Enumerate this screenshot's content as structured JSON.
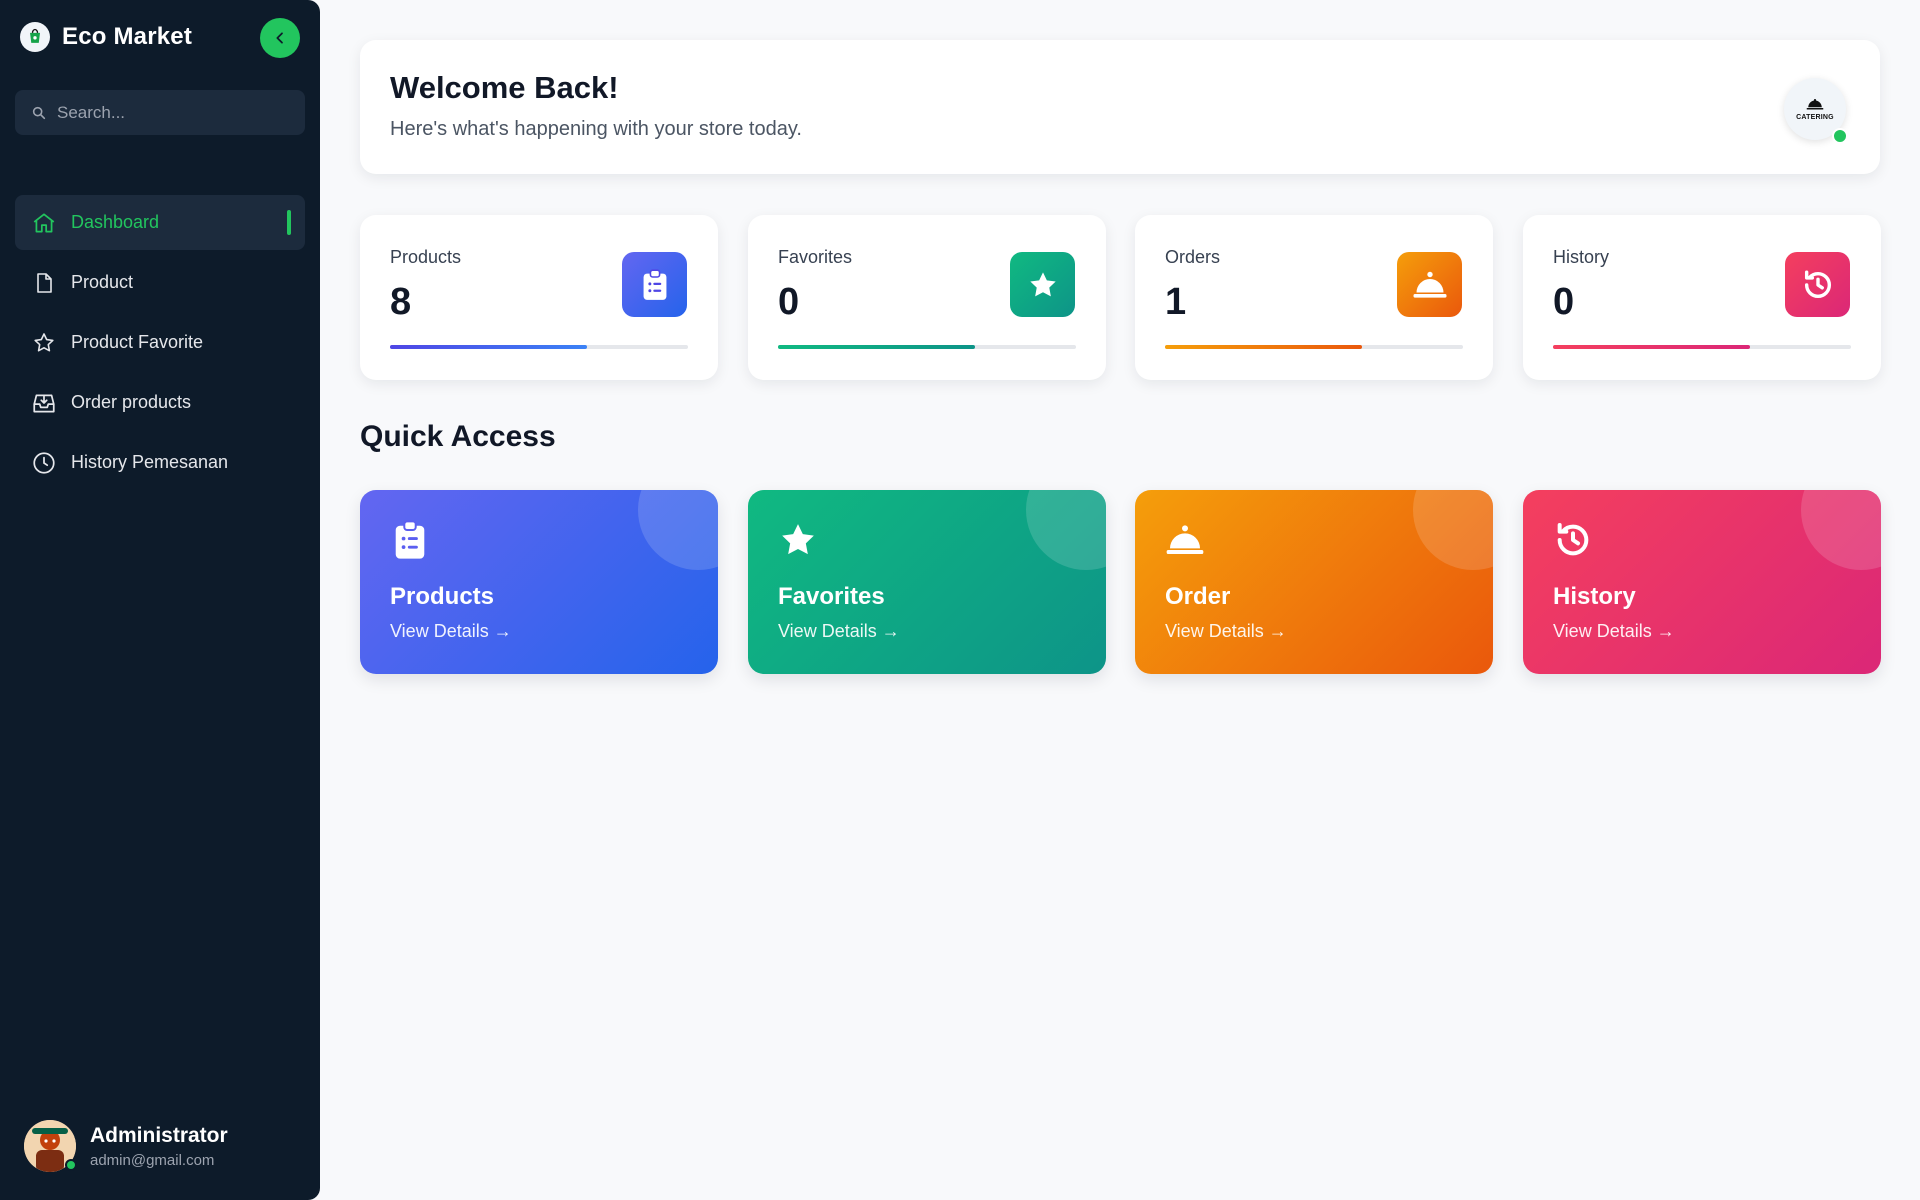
{
  "brand": {
    "name": "Eco Market"
  },
  "search": {
    "placeholder": "Search..."
  },
  "sidebar": {
    "items": [
      {
        "label": "Dashboard",
        "icon": "home-icon",
        "active": true
      },
      {
        "label": "Product",
        "icon": "file-icon"
      },
      {
        "label": "Product Favorite",
        "icon": "star-outline-icon"
      },
      {
        "label": "Order products",
        "icon": "inbox-download-icon"
      },
      {
        "label": "History Pemesanan",
        "icon": "clock-icon"
      }
    ]
  },
  "profile": {
    "name": "Administrator",
    "email": "admin@gmail.com"
  },
  "welcome": {
    "title": "Welcome Back!",
    "subtitle": "Here's what's happening with your store today.",
    "store_logo_text": "CATERING"
  },
  "stats": [
    {
      "label": "Products",
      "value": "8",
      "progress": 0.66,
      "icon": "clipboard-list-icon",
      "color": "#5b5ff0",
      "fill": "#4f46e5"
    },
    {
      "label": "Favorites",
      "value": "0",
      "progress": 0.66,
      "icon": "star-icon",
      "color": "#10a383",
      "fill": "#10b981"
    },
    {
      "label": "Orders",
      "value": "1",
      "progress": 0.66,
      "icon": "service-bell-icon",
      "color": "#f28c0f",
      "fill": "#f59e0b"
    },
    {
      "label": "History",
      "value": "0",
      "progress": 0.66,
      "icon": "history-icon",
      "color": "#eb3f6f",
      "fill": "#f43f5e"
    }
  ],
  "quick_access": {
    "title": "Quick Access",
    "cards": [
      {
        "title": "Products",
        "link": "View Details →",
        "icon": "clipboard-list-icon"
      },
      {
        "title": "Favorites",
        "link": "View Details →",
        "icon": "star-icon"
      },
      {
        "title": "Order",
        "link": "View Details →",
        "icon": "service-bell-icon"
      },
      {
        "title": "History",
        "link": "View Details →",
        "icon": "history-icon"
      }
    ]
  },
  "colors": {
    "sidebar_bg": "#0d1b2a",
    "accent": "#22c55e",
    "page_bg": "#f8f9fb"
  }
}
